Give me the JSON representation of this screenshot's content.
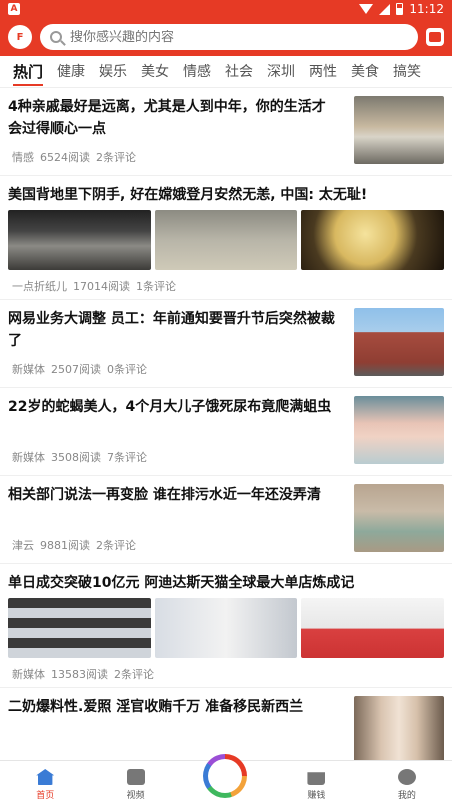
{
  "status_bar": {
    "badge": "A",
    "time": "11:12"
  },
  "header": {
    "logo_text": "F",
    "search_placeholder": "搜你感兴趣的内容"
  },
  "tabs": [
    "热门",
    "健康",
    "娱乐",
    "美女",
    "情感",
    "社会",
    "深圳",
    "两性",
    "美食",
    "搞笑"
  ],
  "articles": [
    {
      "title": "4种亲戚最好是远离，尤其是人到中年，你的生活才会过得顺心一点",
      "source": "情感",
      "reads": "6524阅读",
      "comments": "2条评论"
    },
    {
      "title": "美国背地里下阴手, 好在嫦娥登月安然无恙, 中国: 太无耻!",
      "source": "一点折纸儿",
      "reads": "17014阅读",
      "comments": "1条评论"
    },
    {
      "title": "网易业务大调整 员工：年前通知要晋升节后突然被裁了",
      "source": "新媒体",
      "reads": "2507阅读",
      "comments": "0条评论"
    },
    {
      "title": "22岁的蛇蝎美人，4个月大儿子饿死尿布竟爬满蛆虫",
      "source": "新媒体",
      "reads": "3508阅读",
      "comments": "7条评论"
    },
    {
      "title": "相关部门说法一再变脸 谁在排污水近一年还没弄清",
      "source": "津云",
      "reads": "9881阅读",
      "comments": "2条评论"
    },
    {
      "title": "单日成交突破10亿元 阿迪达斯天猫全球最大单店炼成记",
      "source": "新媒体",
      "reads": "13583阅读",
      "comments": "2条评论"
    },
    {
      "title": "二奶爆料性.爱照 淫官收贿千万 准备移民新西兰",
      "source": "",
      "reads": "",
      "comments": ""
    }
  ],
  "bottom_nav": {
    "home": "首页",
    "video": "视频",
    "earn": "赚钱",
    "mine": "我的"
  },
  "colors": {
    "brand_red": "#e63a25",
    "home_blue": "#3a7bd5"
  }
}
